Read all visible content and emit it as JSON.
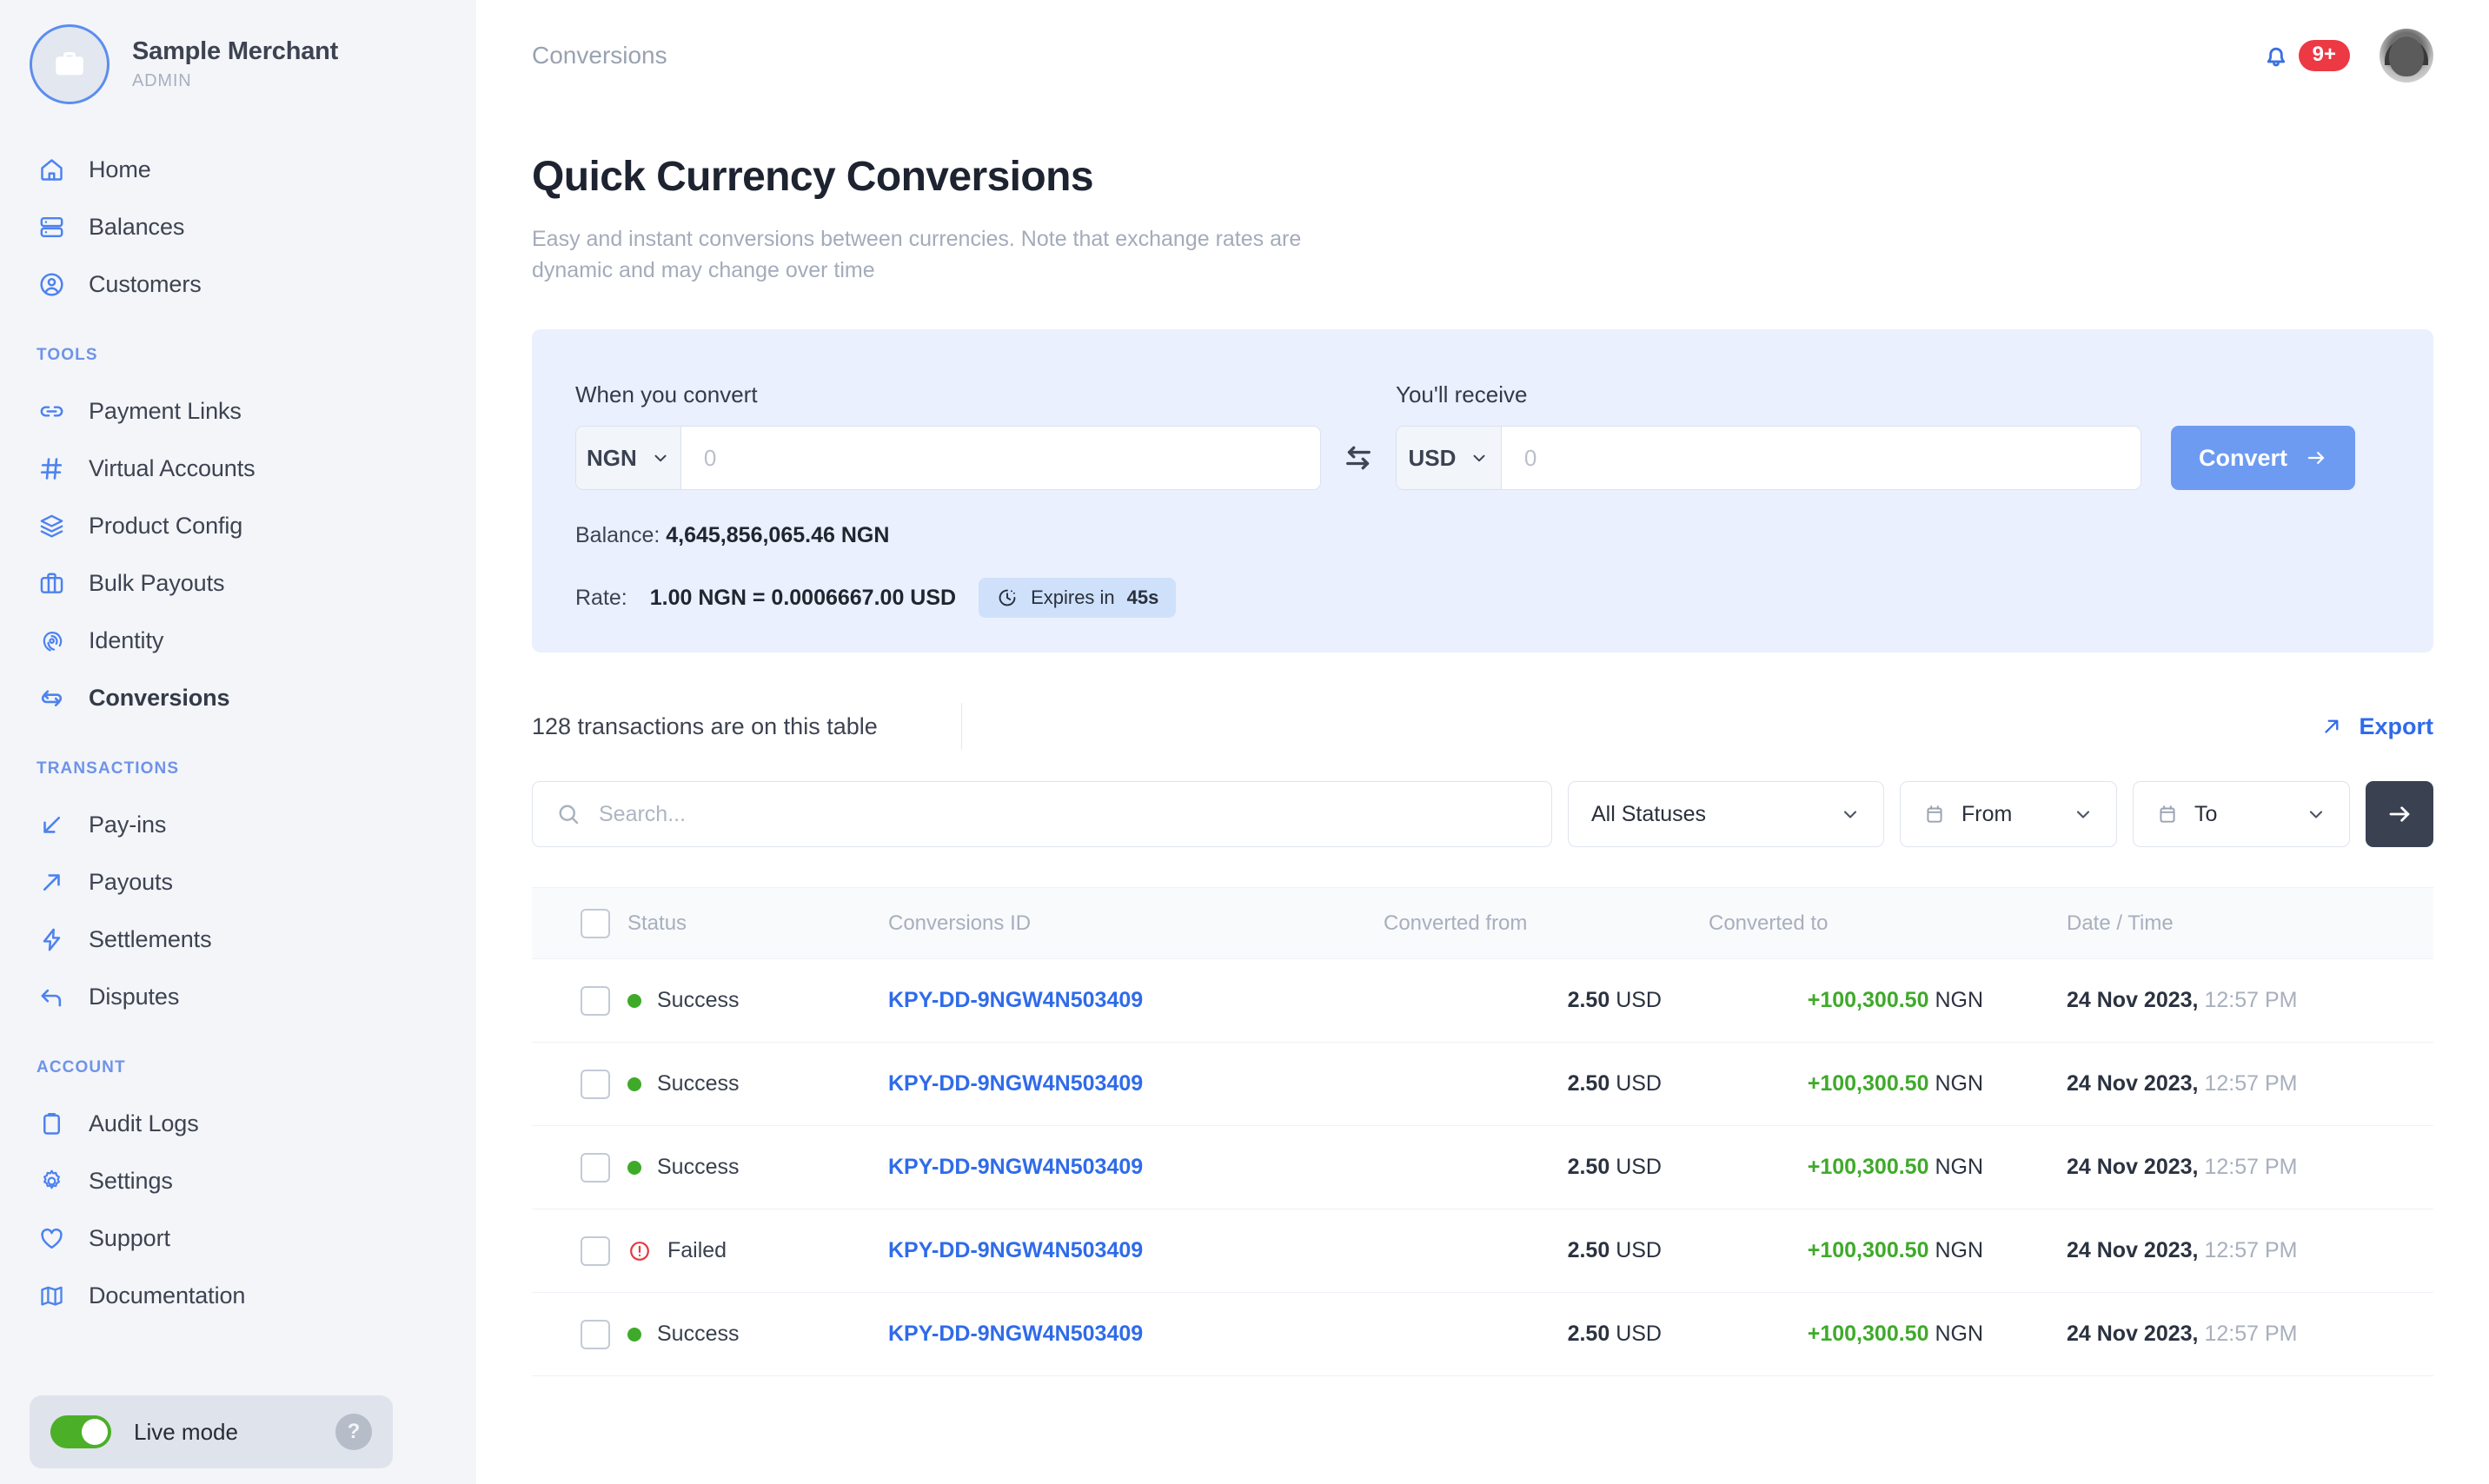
{
  "sidebar": {
    "merchant": {
      "name": "Sample Merchant",
      "role": "ADMIN",
      "avatar_icon": "briefcase-icon"
    },
    "groups": [
      {
        "label": "",
        "items": [
          {
            "label": "Home",
            "icon": "home-icon",
            "active": false
          },
          {
            "label": "Balances",
            "icon": "server-icon",
            "active": false
          },
          {
            "label": "Customers",
            "icon": "user-circle-icon",
            "active": false
          }
        ]
      },
      {
        "label": "TOOLS",
        "items": [
          {
            "label": "Payment Links",
            "icon": "link-icon",
            "active": false
          },
          {
            "label": "Virtual Accounts",
            "icon": "hash-icon",
            "active": false
          },
          {
            "label": "Product Config",
            "icon": "layers-icon",
            "active": false
          },
          {
            "label": "Bulk Payouts",
            "icon": "briefcase-icon",
            "active": false
          },
          {
            "label": "Identity",
            "icon": "fingerprint-icon",
            "active": false
          },
          {
            "label": "Conversions",
            "icon": "repeat-icon",
            "active": true
          }
        ]
      },
      {
        "label": "TRANSACTIONS",
        "items": [
          {
            "label": "Pay-ins",
            "icon": "arrow-down-left-icon",
            "active": false
          },
          {
            "label": "Payouts",
            "icon": "arrow-up-right-icon",
            "active": false
          },
          {
            "label": "Settlements",
            "icon": "bolt-icon",
            "active": false
          },
          {
            "label": "Disputes",
            "icon": "arrow-return-left-icon",
            "active": false
          }
        ]
      },
      {
        "label": "ACCOUNT",
        "items": [
          {
            "label": "Audit Logs",
            "icon": "clipboard-icon",
            "active": false
          },
          {
            "label": "Settings",
            "icon": "gear-icon",
            "active": false
          },
          {
            "label": "Support",
            "icon": "heart-icon",
            "active": false
          },
          {
            "label": "Documentation",
            "icon": "map-icon",
            "active": false
          }
        ]
      }
    ],
    "live_mode": {
      "label": "Live mode",
      "enabled": true,
      "help_glyph": "?"
    }
  },
  "topbar": {
    "breadcrumb": "Conversions",
    "bell_icon": "bell-icon",
    "notification_count": "9+",
    "avatar_name": "avatar"
  },
  "page": {
    "title": "Quick Currency Conversions",
    "subtitle": "Easy and instant conversions between currencies. Note that exchange rates are dynamic and may change over time"
  },
  "converter": {
    "from_label": "When you convert",
    "to_label": "You'll receive",
    "from_currency": "NGN",
    "to_currency": "USD",
    "from_amount": "",
    "to_amount": "",
    "amount_placeholder": "0",
    "swap_icon": "swap-horizontal-icon",
    "convert_label": "Convert",
    "convert_arrow_icon": "arrow-right-icon",
    "balance_prefix": "Balance:",
    "balance_value": "4,645,856,065.46 NGN",
    "rate_prefix": "Rate:",
    "rate_value": "1.00 NGN = 0.0006667.00 USD",
    "expires_prefix": "Expires in",
    "expires_value": "45s",
    "clock_icon": "clock-icon",
    "panel_bg": "#eaf0fd",
    "convert_btn_color": "#6d9bf1"
  },
  "table_toolbar": {
    "count_text": "128 transactions are on this table",
    "export_label": "Export",
    "export_icon": "arrow-up-right-icon",
    "search_placeholder": "Search...",
    "search_value": "",
    "search_icon": "search-icon",
    "status_filter": "All Statuses",
    "from_filter": "From",
    "to_filter": "To",
    "calendar_icon": "calendar-icon",
    "chevron_icon": "chevron-down-icon",
    "go_icon": "arrow-right-icon"
  },
  "table": {
    "columns": [
      "",
      "Status",
      "Conversions ID",
      "Converted from",
      "Converted to",
      "Date / Time"
    ],
    "rows": [
      {
        "status": "Success",
        "status_type": "success",
        "id": "KPY-DD-9NGW4N503409",
        "from_amount": "2.50",
        "from_cur": "USD",
        "to_amount": "+100,300.50",
        "to_cur": "NGN",
        "date": "24 Nov 2023,",
        "time": "12:57 PM"
      },
      {
        "status": "Success",
        "status_type": "success",
        "id": "KPY-DD-9NGW4N503409",
        "from_amount": "2.50",
        "from_cur": "USD",
        "to_amount": "+100,300.50",
        "to_cur": "NGN",
        "date": "24 Nov 2023,",
        "time": "12:57 PM"
      },
      {
        "status": "Success",
        "status_type": "success",
        "id": "KPY-DD-9NGW4N503409",
        "from_amount": "2.50",
        "from_cur": "USD",
        "to_amount": "+100,300.50",
        "to_cur": "NGN",
        "date": "24 Nov 2023,",
        "time": "12:57 PM"
      },
      {
        "status": "Failed",
        "status_type": "failed",
        "id": "KPY-DD-9NGW4N503409",
        "from_amount": "2.50",
        "from_cur": "USD",
        "to_amount": "+100,300.50",
        "to_cur": "NGN",
        "date": "24 Nov 2023,",
        "time": "12:57 PM"
      },
      {
        "status": "Success",
        "status_type": "success",
        "id": "KPY-DD-9NGW4N503409",
        "from_amount": "2.50",
        "from_cur": "USD",
        "to_amount": "+100,300.50",
        "to_cur": "NGN",
        "date": "24 Nov 2023,",
        "time": "12:57 PM"
      }
    ]
  },
  "colors": {
    "accent": "#4d82ef",
    "link": "#2f6bea",
    "success": "#3faa2a",
    "danger": "#e23b43",
    "sidebar_bg": "#f3f5f9"
  }
}
